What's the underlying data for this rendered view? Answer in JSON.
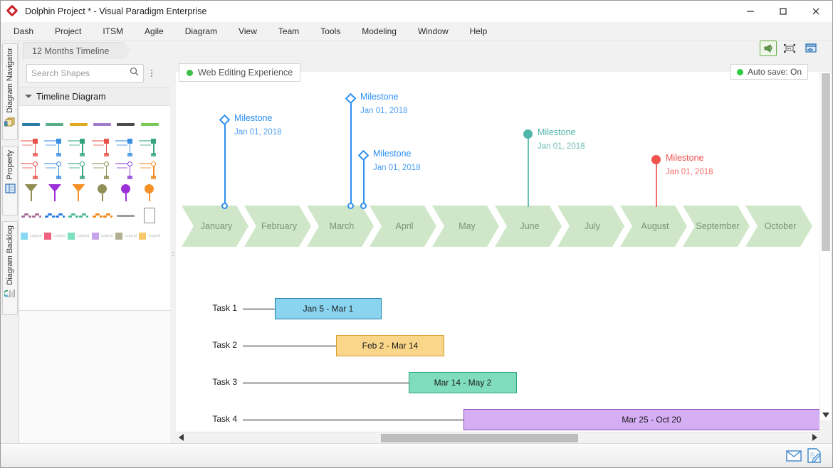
{
  "window": {
    "title": "Dolphin Project * - Visual Paradigm Enterprise",
    "logo_icon": "dolphin-diamond-logo",
    "minimize_label": "minimize-icon",
    "maximize_label": "maximize-icon",
    "close_label": "close-icon"
  },
  "menubar": {
    "items": [
      {
        "label": "Dash"
      },
      {
        "label": "Project"
      },
      {
        "label": "ITSM"
      },
      {
        "label": "Agile"
      },
      {
        "label": "Diagram"
      },
      {
        "label": "View"
      },
      {
        "label": "Team"
      },
      {
        "label": "Tools"
      },
      {
        "label": "Modeling"
      },
      {
        "label": "Window"
      },
      {
        "label": "Help"
      }
    ]
  },
  "doc_tab": {
    "label": "12 Months Timeline"
  },
  "rail": {
    "tabs": [
      {
        "label": "Diagram Navigator",
        "icon": "navigator-icon"
      },
      {
        "label": "Property",
        "icon": "property-icon"
      },
      {
        "label": "Diagram Backlog",
        "icon": "backlog-icon"
      }
    ]
  },
  "shape_panel": {
    "search": {
      "placeholder": "Search Shapes",
      "icon": "search-icon"
    },
    "options_icon": "kebab-menu-icon",
    "section": {
      "label": "Timeline Diagram",
      "caret": "chevron-down-icon"
    },
    "rows": [
      {
        "kind": "bar",
        "items": [
          {
            "name": "bar-blue",
            "color": "#2b7ba5"
          },
          {
            "name": "bar-green",
            "color": "#5cae88"
          },
          {
            "name": "bar-amber",
            "color": "#dfa920"
          },
          {
            "name": "bar-purple",
            "color": "#a07cce"
          },
          {
            "name": "bar-dark",
            "color": "#4c4c4c"
          },
          {
            "name": "bar-lime",
            "color": "#79c958"
          }
        ]
      },
      {
        "kind": "milestone",
        "items": [
          {
            "name": "milestone-red-square",
            "color": "#e8534c"
          },
          {
            "name": "milestone-blue-square",
            "color": "#3a8fe0"
          },
          {
            "name": "milestone-green-square",
            "color": "#36a57e"
          },
          {
            "name": "milestone-red-square-2",
            "color": "#e8534c"
          },
          {
            "name": "milestone-blue-square-2",
            "color": "#3a8fe0"
          },
          {
            "name": "milestone-green-square-2",
            "color": "#36a57e"
          }
        ]
      },
      {
        "kind": "milestone-circle",
        "items": [
          {
            "name": "milestone-red-circle",
            "color": "#e8534c"
          },
          {
            "name": "milestone-blue-circle",
            "color": "#3a8fe0"
          },
          {
            "name": "milestone-green-circle",
            "color": "#36a57e"
          },
          {
            "name": "milestone-olive",
            "color": "#8f8f55"
          },
          {
            "name": "milestone-violet",
            "color": "#8f3fd4"
          },
          {
            "name": "milestone-orange",
            "color": "#f08a1e"
          }
        ]
      },
      {
        "kind": "pin",
        "items": [
          {
            "name": "pin-olive",
            "color": "#8f8f55"
          },
          {
            "name": "pin-violet",
            "color": "#9b30d9"
          },
          {
            "name": "pin-orange",
            "color": "#f69128"
          },
          {
            "name": "pin-olive-round",
            "color": "#8f8f55"
          },
          {
            "name": "pin-violet-round",
            "color": "#9b30d9"
          },
          {
            "name": "pin-orange-round",
            "color": "#f69128"
          }
        ]
      },
      {
        "kind": "wave",
        "items": [
          {
            "name": "wave-mauve",
            "color": "#a96f9a"
          },
          {
            "name": "wave-blue",
            "color": "#2b7ee0"
          },
          {
            "name": "wave-teal",
            "color": "#4fb89a"
          },
          {
            "name": "wave-orange",
            "color": "#f08a1e"
          },
          {
            "name": "divider-gray",
            "color": "#9c9c9c"
          },
          {
            "name": "note-shape",
            "color": "#8d8d8d"
          }
        ]
      },
      {
        "kind": "legend",
        "items": [
          {
            "name": "legend-blue",
            "color": "#87d8f2",
            "label": "Legend"
          },
          {
            "name": "legend-pink",
            "color": "#f2607f",
            "label": "Legend"
          },
          {
            "name": "legend-mint",
            "color": "#7fe0c0",
            "label": "Legend"
          },
          {
            "name": "legend-purple",
            "color": "#c7a4ea",
            "label": "Legend"
          },
          {
            "name": "legend-khaki",
            "color": "#b0b090",
            "label": "Legend"
          },
          {
            "name": "legend-amber",
            "color": "#f7c96b",
            "label": "Legend"
          }
        ]
      }
    ]
  },
  "canvas_header": {
    "diagram_tag": {
      "label": "Web Editing Experience",
      "status_color": "#3fbf45"
    },
    "autosave": {
      "label": "Auto save: On",
      "status_color": "#2ecc40"
    },
    "tools": [
      {
        "name": "broadcast-icon",
        "selected": true
      },
      {
        "name": "fit-selection-icon",
        "selected": false
      },
      {
        "name": "layers-icon",
        "selected": false
      }
    ]
  },
  "chart_data": {
    "type": "timeline",
    "title": "12 Months Timeline",
    "months": [
      "January",
      "February",
      "March",
      "April",
      "May",
      "June",
      "July",
      "August",
      "September",
      "October"
    ],
    "milestones": [
      {
        "name": "Milestone",
        "date": "Jan 01, 2018",
        "color": "#2d8ff0",
        "marker": "diamond",
        "month": "January"
      },
      {
        "name": "Milestone",
        "date": "Jan 01, 2018",
        "color": "#2d8ff0",
        "marker": "diamond",
        "month": "March"
      },
      {
        "name": "Milestone",
        "date": "Jan 01, 2018",
        "color": "#2d8ff0",
        "marker": "diamond",
        "month": "March"
      },
      {
        "name": "Milestone",
        "date": "Jan 01, 2018",
        "color": "#4fb5a8",
        "marker": "circle",
        "month": "June"
      },
      {
        "name": "Milestone",
        "date": "Jan 01, 2018",
        "color": "#ef5350",
        "marker": "circle",
        "month": "August"
      }
    ],
    "tasks": [
      {
        "label": "Task 1",
        "range": "Jan 5 - Mar 1",
        "fill": "#8ad4f0",
        "stroke": "#1f7fa8"
      },
      {
        "label": "Task 2",
        "range": "Feb 2 - Mar 14",
        "fill": "#fad68a",
        "stroke": "#d79b2a"
      },
      {
        "label": "Task 3",
        "range": "Mar 14 - May 2",
        "fill": "#7fddbe",
        "stroke": "#2fa381"
      },
      {
        "label": "Task 4",
        "range": "Mar 25 - Oct 20",
        "fill": "#d6aef4",
        "stroke": "#8d4fc0"
      }
    ],
    "partial_task": {
      "fill": "#efa08a",
      "stroke": "#d9775c"
    }
  },
  "scrollbars": {
    "vertical": {
      "name": "vertical-scrollbar",
      "down_icon": "chevron-down-icon"
    },
    "horizontal": {
      "name": "horizontal-scrollbar",
      "left_icon": "arrow-left-icon",
      "right_icon": "arrow-right-icon"
    }
  },
  "statusbar": {
    "buttons": [
      {
        "name": "message-icon"
      },
      {
        "name": "note-icon"
      }
    ]
  }
}
